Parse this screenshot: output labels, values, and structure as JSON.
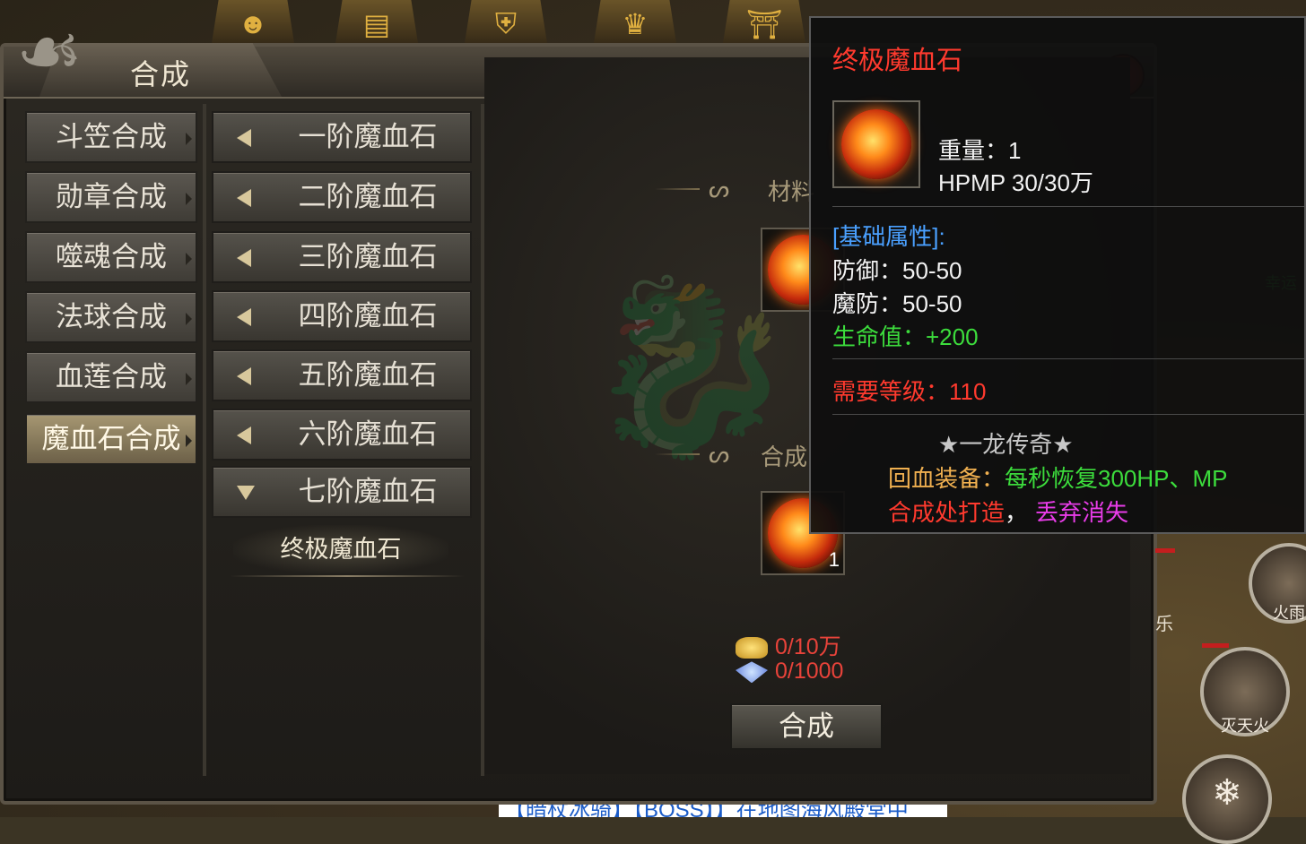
{
  "panel": {
    "title": "合成",
    "close_icon": "close-icon"
  },
  "top_icons": [
    "face-icon",
    "book-icon",
    "shield-icon",
    "helmet-icon",
    "shrine-icon"
  ],
  "categories": [
    {
      "label": "斗笠合成",
      "active": false
    },
    {
      "label": "勋章合成",
      "active": false
    },
    {
      "label": "噬魂合成",
      "active": false
    },
    {
      "label": "法球合成",
      "active": false
    },
    {
      "label": "血莲合成",
      "active": false
    },
    {
      "label": "魔血石合成",
      "active": true
    }
  ],
  "sub_items": [
    {
      "label": "一阶魔血石",
      "expanded": false
    },
    {
      "label": "二阶魔血石",
      "expanded": false
    },
    {
      "label": "三阶魔血石",
      "expanded": false
    },
    {
      "label": "四阶魔血石",
      "expanded": false
    },
    {
      "label": "五阶魔血石",
      "expanded": false
    },
    {
      "label": "六阶魔血石",
      "expanded": false
    },
    {
      "label": "七阶魔血石",
      "expanded": true
    }
  ],
  "leaf_item": "终极魔血石",
  "craft": {
    "material_label": "材料",
    "result_label": "合成",
    "result_count": "1",
    "gold_cost": "0/10万",
    "gem_cost": "0/1000",
    "button": "合成"
  },
  "tooltip": {
    "title": "终极魔血石",
    "weight": "重量：1",
    "hpmp": "HPMP 30/30万",
    "base_header": "[基础属性]:",
    "defense": "防御：50-50",
    "mdefense": "魔防：50-50",
    "hp": "生命值：+200",
    "level_req": "需要等级：110",
    "legend": "★一龙传奇★",
    "effect_label": "回血装备：",
    "effect_value": "每秒恢复300HP、MP",
    "source_label": "合成处打造",
    "source_sep": "，",
    "drop_note": "丢弃消失"
  },
  "hud": {
    "skill1": "火雨",
    "skill2": "灭天火",
    "side_label": "乐",
    "npc_label": "幸运"
  },
  "chat": "【暗杖冰骑】【BOSS】】在地图海风殿堂中",
  "colors": {
    "title_red": "#ff3a2e",
    "attr_blue": "#4aa0ff",
    "hp_green": "#3cdc3c",
    "legend_gray": "#c8c8c8",
    "effect_orange": "#f0b050",
    "magenta": "#e83ce8"
  }
}
